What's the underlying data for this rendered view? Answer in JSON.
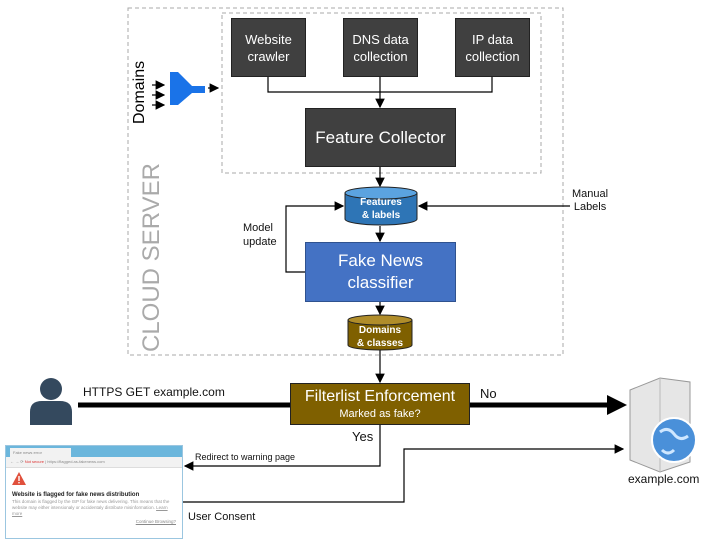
{
  "cloud_server_label": "CLOUD SERVER",
  "domains_label": "Domains",
  "collectors": [
    "Website crawler",
    "DNS data collection",
    "IP data collection"
  ],
  "feature_collector": "Feature Collector",
  "features_db": {
    "line1": "Features",
    "line2": "& labels",
    "color": "#2e75b6"
  },
  "manual_labels": {
    "line1": "Manual",
    "line2": "Labels"
  },
  "model_update": {
    "line1": "Model",
    "line2": "update"
  },
  "classifier": {
    "line1": "Fake News",
    "line2": "classifier",
    "color": "#4472c4"
  },
  "domains_db": {
    "line1": "Domains",
    "line2": "& classes",
    "color": "#7f6000"
  },
  "filterlist": {
    "title": "Filterlist Enforcement",
    "question": "Marked as fake?",
    "color": "#7f6000"
  },
  "request_label": "HTTPS GET example.com",
  "no_label": "No",
  "yes_label": "Yes",
  "redirect_label": "Redirect to warning page",
  "consent_label": "User Consent",
  "server_label": "example.com",
  "funnel_color": "#1a73e8",
  "browser": {
    "tab": "Fake news error",
    "not_secure": "Not secure",
    "url": "https://flagged.as-fakenews.com",
    "heading": "Website is flagged for fake news distribution",
    "body": "This domain is flagged by the ISP for fake news delivering. This means that the website may either intensionaly or accidentaly distribute misinformation.",
    "learn_more": "Learn more",
    "continue": "Continue Browsing?"
  }
}
